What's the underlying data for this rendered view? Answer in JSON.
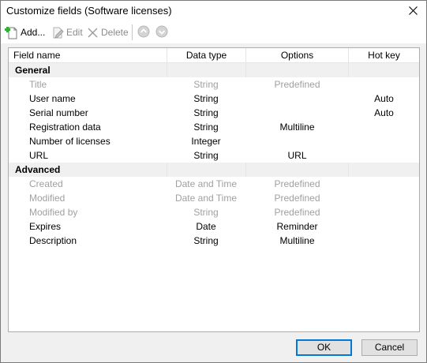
{
  "window": {
    "title": "Customize fields (Software licenses)"
  },
  "toolbar": {
    "add_label": "Add...",
    "edit_label": "Edit",
    "delete_label": "Delete"
  },
  "columns": {
    "field_name": "Field name",
    "data_type": "Data type",
    "options": "Options",
    "hot_key": "Hot key"
  },
  "groups": [
    {
      "label": "General",
      "rows": [
        {
          "name": "Title",
          "type": "String",
          "options": "Predefined",
          "hotkey": "",
          "dim": true
        },
        {
          "name": "User name",
          "type": "String",
          "options": "",
          "hotkey": "Auto",
          "dim": false
        },
        {
          "name": "Serial number",
          "type": "String",
          "options": "",
          "hotkey": "Auto",
          "dim": false
        },
        {
          "name": "Registration data",
          "type": "String",
          "options": "Multiline",
          "hotkey": "",
          "dim": false
        },
        {
          "name": "Number of licenses",
          "type": "Integer",
          "options": "",
          "hotkey": "",
          "dim": false
        },
        {
          "name": "URL",
          "type": "String",
          "options": "URL",
          "hotkey": "",
          "dim": false
        }
      ]
    },
    {
      "label": "Advanced",
      "rows": [
        {
          "name": "Created",
          "type": "Date and Time",
          "options": "Predefined",
          "hotkey": "",
          "dim": true
        },
        {
          "name": "Modified",
          "type": "Date and Time",
          "options": "Predefined",
          "hotkey": "",
          "dim": true
        },
        {
          "name": "Modified by",
          "type": "String",
          "options": "Predefined",
          "hotkey": "",
          "dim": true
        },
        {
          "name": "Expires",
          "type": "Date",
          "options": "Reminder",
          "hotkey": "",
          "dim": false
        },
        {
          "name": "Description",
          "type": "String",
          "options": "Multiline",
          "hotkey": "",
          "dim": false
        }
      ]
    }
  ],
  "footer": {
    "ok_label": "OK",
    "cancel_label": "Cancel"
  },
  "icons": {
    "add": "add-document-icon",
    "edit": "pencil-icon",
    "delete": "x-delete-icon",
    "up": "arrow-up-circle-icon",
    "down": "arrow-down-circle-icon",
    "close": "close-icon"
  },
  "colors": {
    "accent": "#0078d7",
    "group_bg": "#f0f0f0",
    "dim_text": "#a0a0a0"
  }
}
